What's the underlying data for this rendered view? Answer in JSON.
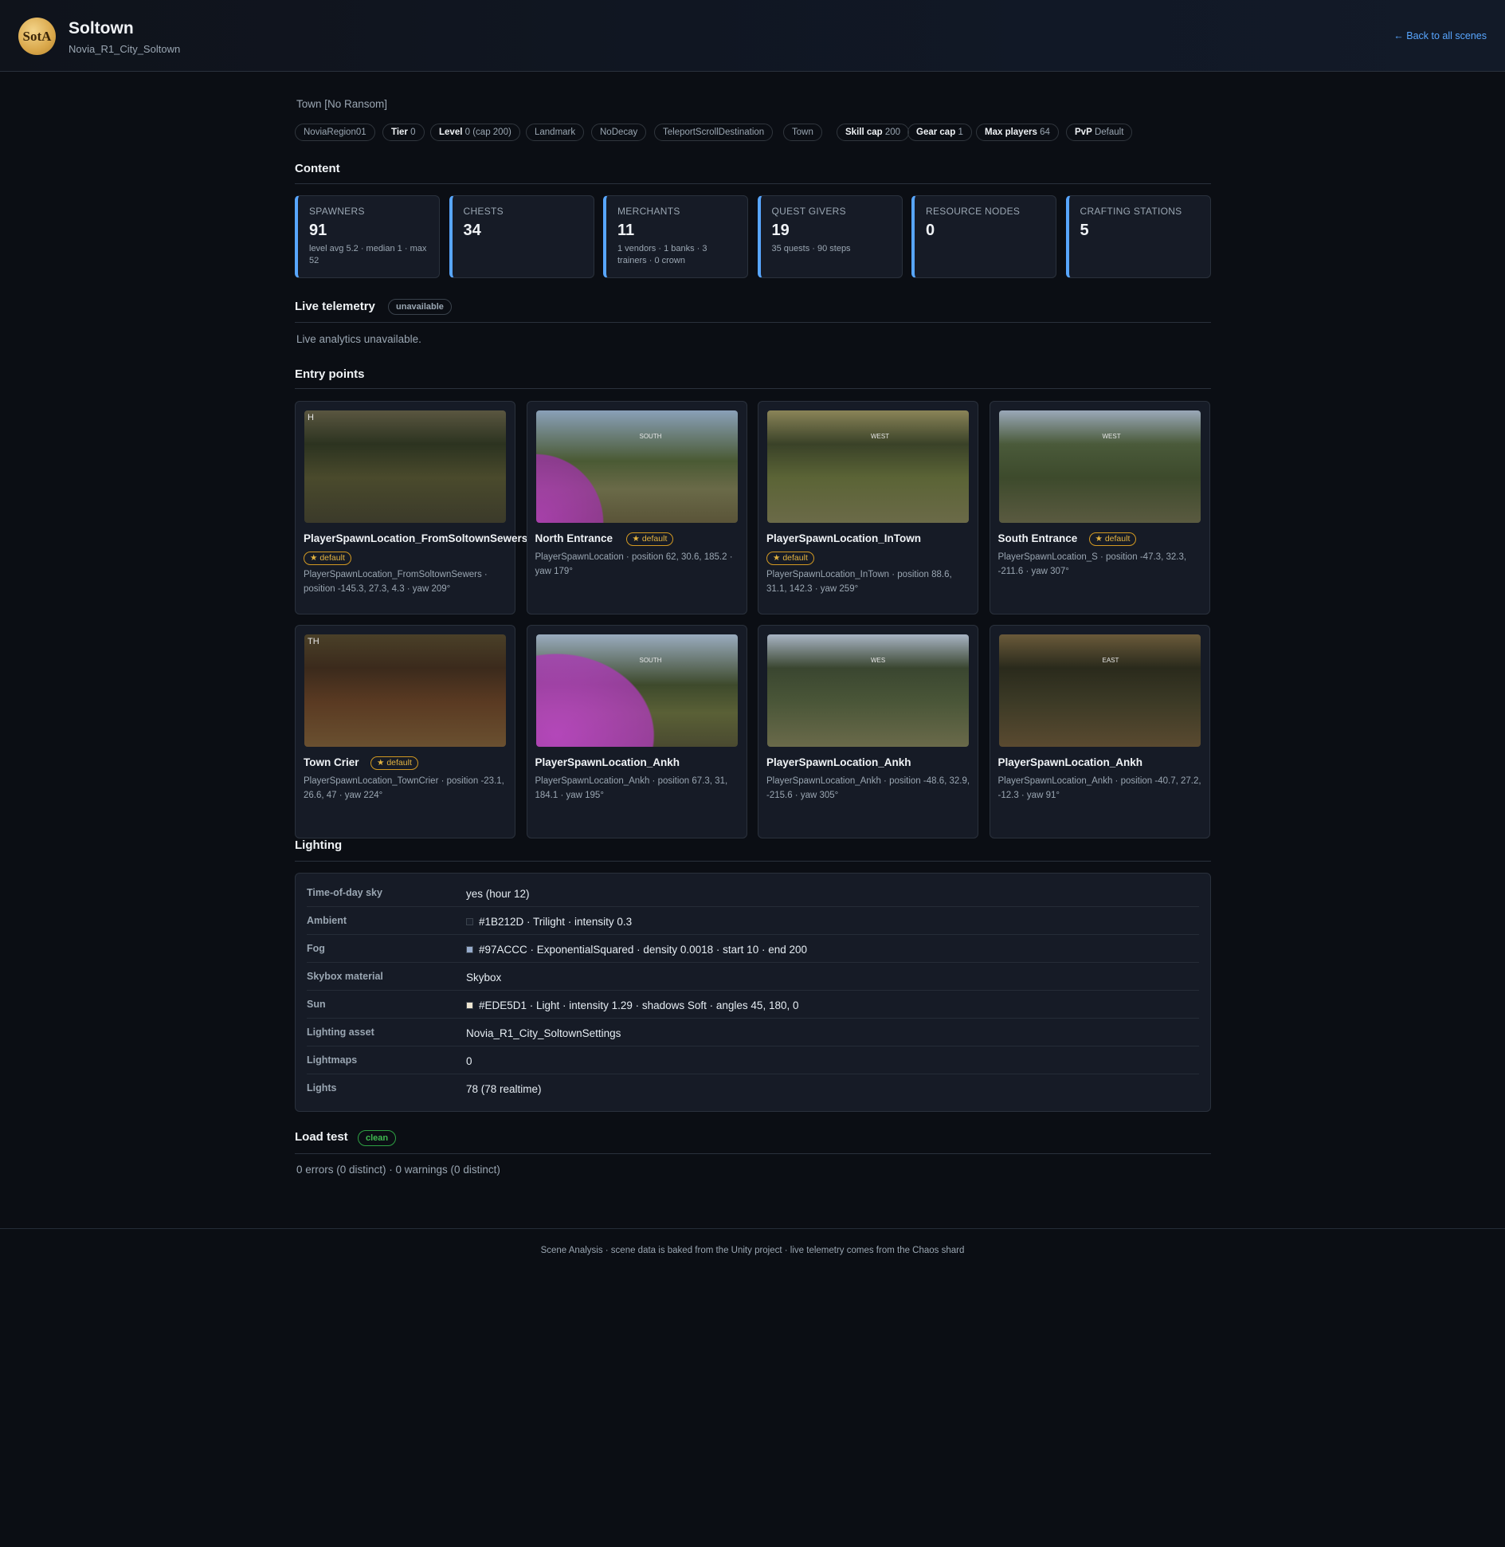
{
  "header": {
    "logo_text": "SotA",
    "title": "Soltown",
    "subtitle": "Novia_R1_City_Soltown",
    "back_link": "← Back to all scenes"
  },
  "scene_kind": "Town [No Ransom]",
  "tags": [
    {
      "key": "",
      "value": "NoviaRegion01"
    },
    {
      "key": "Tier",
      "value": "0"
    },
    {
      "key": "Level",
      "value": "0 (cap 200)"
    },
    {
      "key": "",
      "value": "Landmark"
    },
    {
      "key": "",
      "value": "NoDecay"
    },
    {
      "key": "",
      "value": "TeleportScrollDestination"
    },
    {
      "key": "",
      "value": "Town"
    },
    {
      "key": "Skill cap",
      "value": "200"
    },
    {
      "key": "Gear cap",
      "value": "1"
    },
    {
      "key": "Max players",
      "value": "64"
    },
    {
      "key": "PvP",
      "value": "Default"
    }
  ],
  "content": {
    "title": "Content",
    "stats": [
      {
        "label": "SPAWNERS",
        "value": "91",
        "detail": "level avg 5.2 · median 1 · max 52"
      },
      {
        "label": "CHESTS",
        "value": "34",
        "detail": ""
      },
      {
        "label": "MERCHANTS",
        "value": "11",
        "detail": "1 vendors · 1 banks · 3 trainers · 0 crown"
      },
      {
        "label": "QUEST GIVERS",
        "value": "19",
        "detail": "35 quests · 90 steps"
      },
      {
        "label": "RESOURCE NODES",
        "value": "0",
        "detail": ""
      },
      {
        "label": "CRAFTING STATIONS",
        "value": "5",
        "detail": ""
      }
    ]
  },
  "telemetry": {
    "title": "Live telemetry",
    "status": "unavailable",
    "message": "Live analytics unavailable."
  },
  "entry_points": {
    "title": "Entry points",
    "default_label": "★ default",
    "items": [
      {
        "name": "PlayerSpawnLocation_FromSoltownSewers",
        "default": true,
        "thumb_letters": "H",
        "meta": "PlayerSpawnLocation_FromSoltownSewers · position -145.3, 27.3, 4.3 · yaw 209°"
      },
      {
        "name": "North Entrance",
        "default": true,
        "thumb_letters": "SOUTH",
        "meta": "PlayerSpawnLocation · position 62, 30.6, 185.2 · yaw 179°"
      },
      {
        "name": "PlayerSpawnLocation_InTown",
        "default": true,
        "thumb_letters": "WEST",
        "meta": "PlayerSpawnLocation_InTown · position 88.6, 31.1, 142.3 · yaw 259°"
      },
      {
        "name": "South Entrance",
        "default": true,
        "thumb_letters": "WEST",
        "meta": "PlayerSpawnLocation_S · position -47.3, 32.3, -211.6 · yaw 307°"
      },
      {
        "name": "Town Crier",
        "default": true,
        "thumb_letters": "TH",
        "meta": "PlayerSpawnLocation_TownCrier · position -23.1, 26.6, 47 · yaw 224°"
      },
      {
        "name": "PlayerSpawnLocation_Ankh",
        "default": false,
        "thumb_letters": "SOUTH",
        "meta": "PlayerSpawnLocation_Ankh · position 67.3, 31, 184.1 · yaw 195°"
      },
      {
        "name": "PlayerSpawnLocation_Ankh",
        "default": false,
        "thumb_letters": "WES",
        "meta": "PlayerSpawnLocation_Ankh · position -48.6, 32.9, -215.6 · yaw 305°"
      },
      {
        "name": "PlayerSpawnLocation_Ankh",
        "default": false,
        "thumb_letters": "EAST",
        "meta": "PlayerSpawnLocation_Ankh · position -40.7, 27.2, -12.3 · yaw 91°"
      }
    ]
  },
  "lighting": {
    "title": "Lighting",
    "rows": [
      {
        "key": "Time-of-day sky",
        "value": "yes (hour 12)",
        "swatch": ""
      },
      {
        "key": "Ambient",
        "value": "#1B212D · Trilight · intensity 0.3",
        "swatch": "#1B212D"
      },
      {
        "key": "Fog",
        "value": "#97ACCC · ExponentialSquared · density 0.0018 · start 10 · end 200",
        "swatch": "#97ACCC"
      },
      {
        "key": "Skybox material",
        "value": "Skybox",
        "swatch": ""
      },
      {
        "key": "Sun",
        "value": "#EDE5D1 · Light · intensity 1.29 · shadows Soft · angles 45, 180, 0",
        "swatch": "#EDE5D1"
      },
      {
        "key": "Lighting asset",
        "value": "Novia_R1_City_SoltownSettings",
        "swatch": ""
      },
      {
        "key": "Lightmaps",
        "value": "0",
        "swatch": ""
      },
      {
        "key": "Lights",
        "value": "78 (78 realtime)",
        "swatch": ""
      }
    ]
  },
  "load_test": {
    "title": "Load test",
    "status": "clean",
    "message": "0 errors (0 distinct) · 0 warnings (0 distinct)"
  },
  "footer": "Scene Analysis · scene data is baked from the Unity project · live telemetry comes from the Chaos shard",
  "colors": {
    "accent": "#58A6FF",
    "default_badge": "#D29922",
    "clean_status": "#3FB950",
    "background": "#0B0E14"
  }
}
